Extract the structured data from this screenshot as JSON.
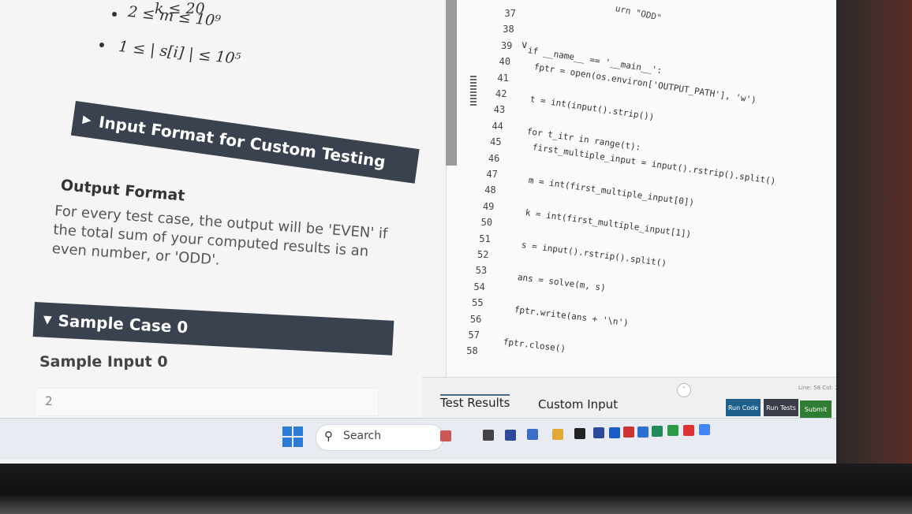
{
  "problem": {
    "constraints": [
      "2 ≤ m ≤ 10⁹",
      "1 ≤ | s[i] | ≤ 10⁵"
    ],
    "partial_constraint": "k ≤ 20",
    "input_format_title": "Input Format for Custom Testing",
    "output_format_title": "Output Format",
    "output_format_text": "For every test case, the output will be 'EVEN' if the total sum of your computed results is an even number, or 'ODD'.",
    "sample_case_title": "Sample Case 0",
    "sample_input_title": "Sample Input 0",
    "sample_input_value": "2",
    "expand_icon": "triangle-right-icon",
    "collapse_icon": "triangle-down-icon"
  },
  "editor": {
    "top_fragment": "urn \"ODD\"",
    "line_numbers": [
      "37",
      "38",
      "39",
      "40",
      "41",
      "42",
      "43",
      "44",
      "45",
      "46",
      "47",
      "48",
      "49",
      "50",
      "51",
      "52",
      "53",
      "54",
      "55",
      "56",
      "57",
      "58"
    ],
    "lines": [
      "",
      "",
      "if __name__ == '__main__':",
      "    fptr = open(os.environ['OUTPUT_PATH'], 'w')",
      "",
      "    t = int(input().strip())",
      "",
      "    for t_itr in range(t):",
      "        first_multiple_input = input().rstrip().split()",
      "",
      "        m = int(first_multiple_input[0])",
      "",
      "        k = int(first_multiple_input[1])",
      "",
      "        s = input().rstrip().split()",
      "",
      "        ans = solve(m, s)",
      "",
      "        fptr.write(ans + '\\n')",
      "",
      "    fptr.close()",
      ""
    ],
    "fold_marker": "∨"
  },
  "bottom": {
    "tabs": [
      "Test Results",
      "Custom Input"
    ],
    "buttons": [
      "Run Code",
      "Run Tests",
      "Submit"
    ],
    "status": "Line: 58 Col: 1"
  },
  "taskbar": {
    "search_placeholder": "Search",
    "start_icon": "windows-start-icon",
    "search_icon": "search-icon"
  },
  "colors": {
    "dark_bar": "#39424e",
    "run_button": "#1f5f8b",
    "submit_button": "#2e7d32",
    "keyword": "#0b5cad"
  }
}
